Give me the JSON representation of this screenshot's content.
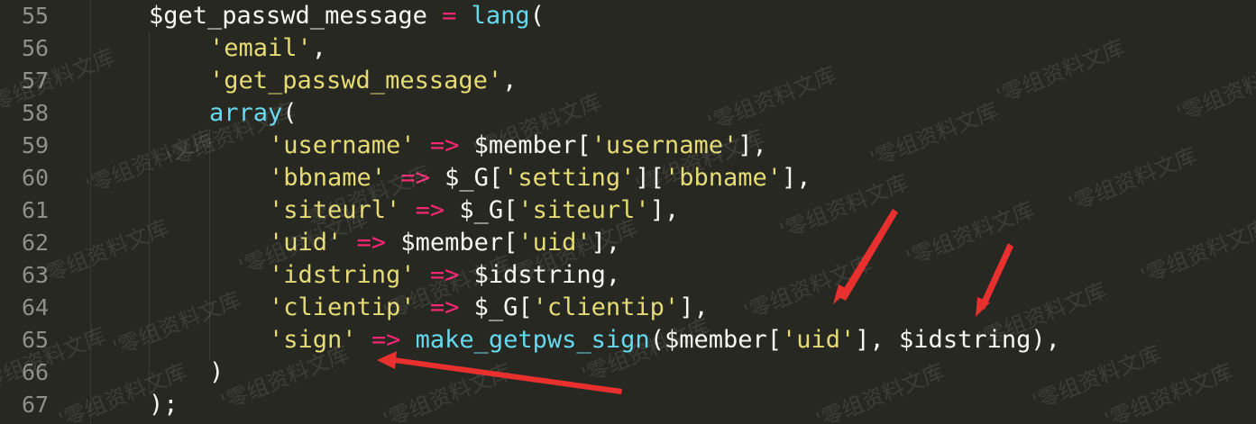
{
  "editor": {
    "line_numbers": [
      "55",
      "56",
      "57",
      "58",
      "59",
      "60",
      "61",
      "62",
      "63",
      "64",
      "65",
      "66",
      "67"
    ],
    "lines": [
      [
        {
          "t": "$get_passwd_message ",
          "c": "pl"
        },
        {
          "t": "=",
          "c": "op"
        },
        {
          "t": " ",
          "c": "pl"
        },
        {
          "t": "lang",
          "c": "fn"
        },
        {
          "t": "(",
          "c": "pl"
        }
      ],
      [
        {
          "t": "'email'",
          "c": "str"
        },
        {
          "t": ",",
          "c": "pl"
        }
      ],
      [
        {
          "t": "'get_passwd_message'",
          "c": "str"
        },
        {
          "t": ",",
          "c": "pl"
        }
      ],
      [
        {
          "t": "array",
          "c": "fn"
        },
        {
          "t": "(",
          "c": "pl"
        }
      ],
      [
        {
          "t": "'username'",
          "c": "str"
        },
        {
          "t": " ",
          "c": "pl"
        },
        {
          "t": "=>",
          "c": "op"
        },
        {
          "t": " $member[",
          "c": "pl"
        },
        {
          "t": "'username'",
          "c": "str"
        },
        {
          "t": "],",
          "c": "pl"
        }
      ],
      [
        {
          "t": "'bbname'",
          "c": "str"
        },
        {
          "t": " ",
          "c": "pl"
        },
        {
          "t": "=>",
          "c": "op"
        },
        {
          "t": " $_G[",
          "c": "pl"
        },
        {
          "t": "'setting'",
          "c": "str"
        },
        {
          "t": "][",
          "c": "pl"
        },
        {
          "t": "'bbname'",
          "c": "str"
        },
        {
          "t": "],",
          "c": "pl"
        }
      ],
      [
        {
          "t": "'siteurl'",
          "c": "str"
        },
        {
          "t": " ",
          "c": "pl"
        },
        {
          "t": "=>",
          "c": "op"
        },
        {
          "t": " $_G[",
          "c": "pl"
        },
        {
          "t": "'siteurl'",
          "c": "str"
        },
        {
          "t": "],",
          "c": "pl"
        }
      ],
      [
        {
          "t": "'uid'",
          "c": "str"
        },
        {
          "t": " ",
          "c": "pl"
        },
        {
          "t": "=>",
          "c": "op"
        },
        {
          "t": " $member[",
          "c": "pl"
        },
        {
          "t": "'uid'",
          "c": "str"
        },
        {
          "t": "],",
          "c": "pl"
        }
      ],
      [
        {
          "t": "'idstring'",
          "c": "str"
        },
        {
          "t": " ",
          "c": "pl"
        },
        {
          "t": "=>",
          "c": "op"
        },
        {
          "t": " $idstring,",
          "c": "pl"
        }
      ],
      [
        {
          "t": "'clientip'",
          "c": "str"
        },
        {
          "t": " ",
          "c": "pl"
        },
        {
          "t": "=>",
          "c": "op"
        },
        {
          "t": " $_G[",
          "c": "pl"
        },
        {
          "t": "'clientip'",
          "c": "str"
        },
        {
          "t": "],",
          "c": "pl"
        }
      ],
      [
        {
          "t": "'sign'",
          "c": "str"
        },
        {
          "t": " ",
          "c": "pl"
        },
        {
          "t": "=>",
          "c": "op"
        },
        {
          "t": " ",
          "c": "pl"
        },
        {
          "t": "make_getpws_sign",
          "c": "fn"
        },
        {
          "t": "($member[",
          "c": "pl"
        },
        {
          "t": "'uid'",
          "c": "str"
        },
        {
          "t": "], $idstring),",
          "c": "pl"
        }
      ],
      [
        {
          "t": ")",
          "c": "pl"
        }
      ],
      [
        {
          "t": ");",
          "c": "pl"
        }
      ]
    ]
  },
  "watermark": {
    "text": "零组资料文库"
  },
  "annotations": {
    "arrow_color": "#e8302f"
  },
  "colors": {
    "background": "#272822",
    "string": "#e6db74",
    "operator": "#f92672",
    "function": "#66d9ef",
    "plain": "#f8f8f2",
    "line_number": "#8f908a"
  }
}
